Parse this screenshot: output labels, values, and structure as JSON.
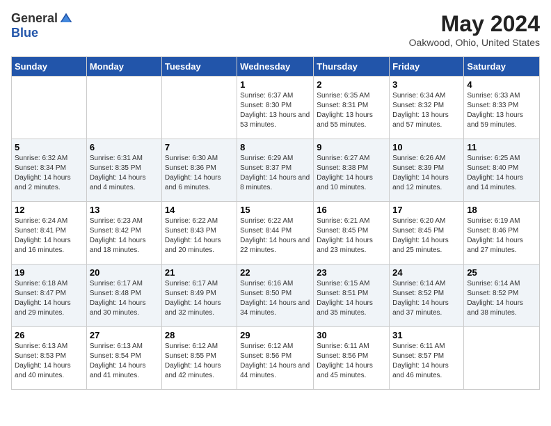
{
  "header": {
    "logo_general": "General",
    "logo_blue": "Blue",
    "month_title": "May 2024",
    "location": "Oakwood, Ohio, United States"
  },
  "days_of_week": [
    "Sunday",
    "Monday",
    "Tuesday",
    "Wednesday",
    "Thursday",
    "Friday",
    "Saturday"
  ],
  "weeks": [
    [
      {
        "day": "",
        "info": ""
      },
      {
        "day": "",
        "info": ""
      },
      {
        "day": "",
        "info": ""
      },
      {
        "day": "1",
        "info": "Sunrise: 6:37 AM\nSunset: 8:30 PM\nDaylight: 13 hours\nand 53 minutes."
      },
      {
        "day": "2",
        "info": "Sunrise: 6:35 AM\nSunset: 8:31 PM\nDaylight: 13 hours\nand 55 minutes."
      },
      {
        "day": "3",
        "info": "Sunrise: 6:34 AM\nSunset: 8:32 PM\nDaylight: 13 hours\nand 57 minutes."
      },
      {
        "day": "4",
        "info": "Sunrise: 6:33 AM\nSunset: 8:33 PM\nDaylight: 13 hours\nand 59 minutes."
      }
    ],
    [
      {
        "day": "5",
        "info": "Sunrise: 6:32 AM\nSunset: 8:34 PM\nDaylight: 14 hours\nand 2 minutes."
      },
      {
        "day": "6",
        "info": "Sunrise: 6:31 AM\nSunset: 8:35 PM\nDaylight: 14 hours\nand 4 minutes."
      },
      {
        "day": "7",
        "info": "Sunrise: 6:30 AM\nSunset: 8:36 PM\nDaylight: 14 hours\nand 6 minutes."
      },
      {
        "day": "8",
        "info": "Sunrise: 6:29 AM\nSunset: 8:37 PM\nDaylight: 14 hours\nand 8 minutes."
      },
      {
        "day": "9",
        "info": "Sunrise: 6:27 AM\nSunset: 8:38 PM\nDaylight: 14 hours\nand 10 minutes."
      },
      {
        "day": "10",
        "info": "Sunrise: 6:26 AM\nSunset: 8:39 PM\nDaylight: 14 hours\nand 12 minutes."
      },
      {
        "day": "11",
        "info": "Sunrise: 6:25 AM\nSunset: 8:40 PM\nDaylight: 14 hours\nand 14 minutes."
      }
    ],
    [
      {
        "day": "12",
        "info": "Sunrise: 6:24 AM\nSunset: 8:41 PM\nDaylight: 14 hours\nand 16 minutes."
      },
      {
        "day": "13",
        "info": "Sunrise: 6:23 AM\nSunset: 8:42 PM\nDaylight: 14 hours\nand 18 minutes."
      },
      {
        "day": "14",
        "info": "Sunrise: 6:22 AM\nSunset: 8:43 PM\nDaylight: 14 hours\nand 20 minutes."
      },
      {
        "day": "15",
        "info": "Sunrise: 6:22 AM\nSunset: 8:44 PM\nDaylight: 14 hours\nand 22 minutes."
      },
      {
        "day": "16",
        "info": "Sunrise: 6:21 AM\nSunset: 8:45 PM\nDaylight: 14 hours\nand 23 minutes."
      },
      {
        "day": "17",
        "info": "Sunrise: 6:20 AM\nSunset: 8:45 PM\nDaylight: 14 hours\nand 25 minutes."
      },
      {
        "day": "18",
        "info": "Sunrise: 6:19 AM\nSunset: 8:46 PM\nDaylight: 14 hours\nand 27 minutes."
      }
    ],
    [
      {
        "day": "19",
        "info": "Sunrise: 6:18 AM\nSunset: 8:47 PM\nDaylight: 14 hours\nand 29 minutes."
      },
      {
        "day": "20",
        "info": "Sunrise: 6:17 AM\nSunset: 8:48 PM\nDaylight: 14 hours\nand 30 minutes."
      },
      {
        "day": "21",
        "info": "Sunrise: 6:17 AM\nSunset: 8:49 PM\nDaylight: 14 hours\nand 32 minutes."
      },
      {
        "day": "22",
        "info": "Sunrise: 6:16 AM\nSunset: 8:50 PM\nDaylight: 14 hours\nand 34 minutes."
      },
      {
        "day": "23",
        "info": "Sunrise: 6:15 AM\nSunset: 8:51 PM\nDaylight: 14 hours\nand 35 minutes."
      },
      {
        "day": "24",
        "info": "Sunrise: 6:14 AM\nSunset: 8:52 PM\nDaylight: 14 hours\nand 37 minutes."
      },
      {
        "day": "25",
        "info": "Sunrise: 6:14 AM\nSunset: 8:52 PM\nDaylight: 14 hours\nand 38 minutes."
      }
    ],
    [
      {
        "day": "26",
        "info": "Sunrise: 6:13 AM\nSunset: 8:53 PM\nDaylight: 14 hours\nand 40 minutes."
      },
      {
        "day": "27",
        "info": "Sunrise: 6:13 AM\nSunset: 8:54 PM\nDaylight: 14 hours\nand 41 minutes."
      },
      {
        "day": "28",
        "info": "Sunrise: 6:12 AM\nSunset: 8:55 PM\nDaylight: 14 hours\nand 42 minutes."
      },
      {
        "day": "29",
        "info": "Sunrise: 6:12 AM\nSunset: 8:56 PM\nDaylight: 14 hours\nand 44 minutes."
      },
      {
        "day": "30",
        "info": "Sunrise: 6:11 AM\nSunset: 8:56 PM\nDaylight: 14 hours\nand 45 minutes."
      },
      {
        "day": "31",
        "info": "Sunrise: 6:11 AM\nSunset: 8:57 PM\nDaylight: 14 hours\nand 46 minutes."
      },
      {
        "day": "",
        "info": ""
      }
    ]
  ]
}
